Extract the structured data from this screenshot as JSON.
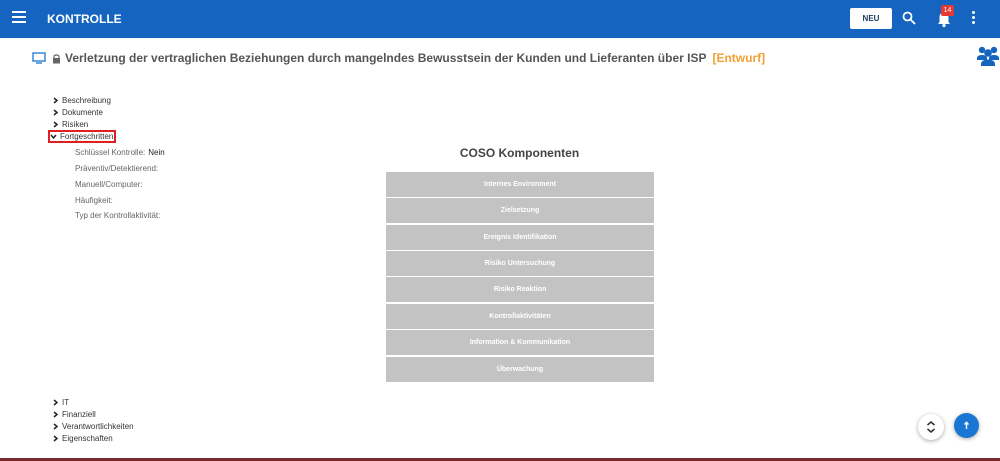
{
  "appbar": {
    "title": "KONTROLLE",
    "new_label": "NEU",
    "notification_count": "14",
    "menu_icon": "hamburger-icon",
    "search_icon": "search-icon",
    "bell_icon": "bell-icon",
    "more_icon": "more-vertical-icon"
  },
  "page": {
    "title": "Verletzung der vertraglichen Beziehungen durch mangelndes Bewusstsein der Kunden und Lieferanten über ISP",
    "status": "[Entwurf]"
  },
  "sections_top": [
    {
      "label": "Beschreibung",
      "expanded": false
    },
    {
      "label": "Dokumente",
      "expanded": false
    },
    {
      "label": "Risiken",
      "expanded": false
    },
    {
      "label": "Fortgeschritten",
      "expanded": true
    }
  ],
  "fields": [
    {
      "label": "Schlüssel Kontrolle:",
      "value": "Nein"
    },
    {
      "label": "Präventiv/Detektierend:",
      "value": ""
    },
    {
      "label": "Manuell/Computer:",
      "value": ""
    },
    {
      "label": "Häufigkeit:",
      "value": ""
    },
    {
      "label": "Typ der Kontrollaktivität:",
      "value": ""
    }
  ],
  "coso": {
    "title": "COSO Komponenten",
    "components": [
      "Internes Environment",
      "Zielsetzung",
      "Ereignis Identifikation",
      "Risiko Untersuchung",
      "Risiko Reaktion",
      "Kontrollaktivitäten",
      "Information & Kommunikation",
      "Überwachung"
    ]
  },
  "sections_bottom": [
    {
      "label": "IT",
      "expanded": false
    },
    {
      "label": "Finanziell",
      "expanded": false
    },
    {
      "label": "Verantwortlichkeiten",
      "expanded": false
    },
    {
      "label": "Eigenschaften",
      "expanded": false
    }
  ],
  "colors": {
    "appbar": "#1565c0",
    "status": "#f0a030",
    "coso_button": "#c3c3c3",
    "highlight": "#e02020"
  }
}
